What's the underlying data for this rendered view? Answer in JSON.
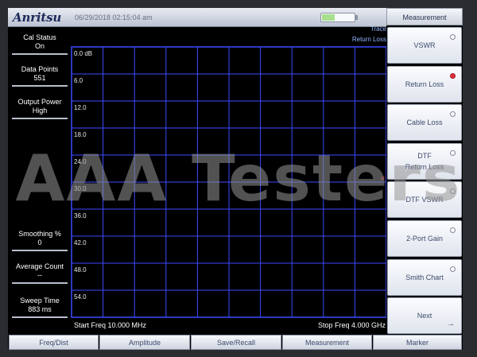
{
  "brand": "Anritsu",
  "datetime": "06/29/2018 02:15:04 am",
  "battery_level": 0.4,
  "left_panel": [
    {
      "label": "Cal Status",
      "value": "On"
    },
    {
      "label": "Data Points",
      "value": "551"
    },
    {
      "label": "Output Power",
      "value": "High"
    },
    {
      "label": "Smoothing %",
      "value": "0"
    },
    {
      "label": "Average Count",
      "value": "--"
    },
    {
      "label": "Sweep Time",
      "value": "883 ms"
    }
  ],
  "trace": {
    "line1": "Trace",
    "line2": "Return Loss"
  },
  "plot": {
    "y_labels": [
      "0.0 dB",
      "6.0",
      "12.0",
      "18.0",
      "24.0",
      "30.0",
      "36.0",
      "42.0",
      "48.0",
      "54.0"
    ],
    "start_freq": "Start Freq 10.000 MHz",
    "stop_freq": "Stop Freq 4.000 GHz",
    "grid_color": "#3d4aff",
    "marker_symbol": "R"
  },
  "softkeys": {
    "title": "Measurement",
    "items": [
      {
        "label": "VSWR",
        "selected": false
      },
      {
        "label": "Return Loss",
        "selected": true
      },
      {
        "label": "Cable Loss",
        "selected": false
      },
      {
        "label": "DTF\nReturn Loss",
        "selected": false
      },
      {
        "label": "DTF VSWR",
        "selected": false
      },
      {
        "label": "2-Port Gain",
        "selected": false
      },
      {
        "label": "Smith Chart",
        "selected": false
      },
      {
        "label": "Next",
        "selected": false
      }
    ],
    "next_arrow": "→"
  },
  "tabs": [
    "Freq/Dist",
    "Amplitude",
    "Save/Recall",
    "Measurement",
    "Marker"
  ],
  "watermark": "AAA Testers"
}
